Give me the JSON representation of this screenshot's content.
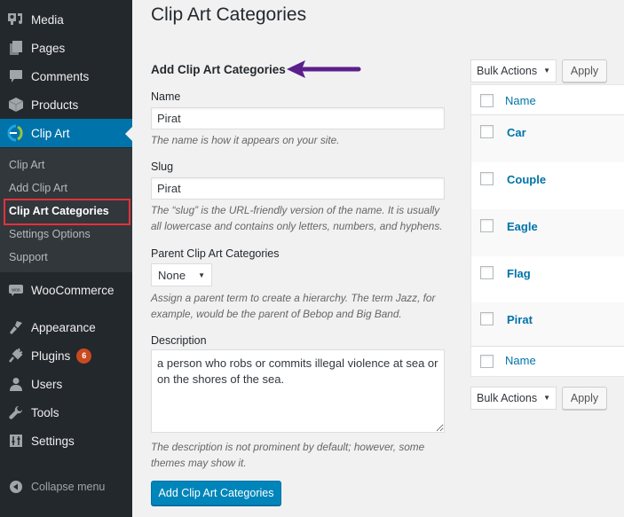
{
  "sidebar": {
    "items": [
      {
        "label": "Media",
        "icon": "media-icon"
      },
      {
        "label": "Pages",
        "icon": "pages-icon"
      },
      {
        "label": "Comments",
        "icon": "comments-icon"
      },
      {
        "label": "Products",
        "icon": "products-icon"
      },
      {
        "label": "Clip Art",
        "icon": "clip-art-icon",
        "active": true
      },
      {
        "label": "WooCommerce",
        "icon": "woocommerce-icon"
      },
      {
        "label": "Appearance",
        "icon": "appearance-icon"
      },
      {
        "label": "Plugins",
        "icon": "plugins-icon",
        "badge": "6"
      },
      {
        "label": "Users",
        "icon": "users-icon"
      },
      {
        "label": "Tools",
        "icon": "tools-icon"
      },
      {
        "label": "Settings",
        "icon": "settings-icon"
      }
    ],
    "submenu": [
      {
        "label": "Clip Art"
      },
      {
        "label": "Add Clip Art"
      },
      {
        "label": "Clip Art Categories",
        "current": true
      },
      {
        "label": "Settings Options"
      },
      {
        "label": "Support"
      }
    ],
    "collapse_label": "Collapse menu",
    "colors": {
      "background": "#23282d",
      "active": "#0073aa",
      "highlight_box": "#e2333b",
      "badge": "#ca4a1f"
    }
  },
  "main": {
    "page_title": "Clip Art Categories",
    "form": {
      "title": "Add Clip Art Categories",
      "annotation_arrow_color": "#5b1f8c",
      "name": {
        "label": "Name",
        "value": "Pirat",
        "help": "The name is how it appears on your site."
      },
      "slug": {
        "label": "Slug",
        "value": "Pirat",
        "help": "The “slug” is the URL-friendly version of the name. It is usually all lowercase and contains only letters, numbers, and hyphens."
      },
      "parent": {
        "label": "Parent Clip Art Categories",
        "value": "None",
        "help": "Assign a parent term to create a hierarchy. The term Jazz, for example, would be the parent of Bebop and Big Band."
      },
      "description": {
        "label": "Description",
        "value": "a person who robs or commits illegal violence at sea or on the shores of the sea.",
        "help": "The description is not prominent by default; however, some themes may show it."
      },
      "submit_label": "Add Clip Art Categories"
    },
    "table": {
      "bulk_actions_label": "Bulk Actions",
      "apply_label": "Apply",
      "column_name": "Name",
      "rows": [
        {
          "name": "Car"
        },
        {
          "name": "Couple"
        },
        {
          "name": "Eagle"
        },
        {
          "name": "Flag"
        },
        {
          "name": "Pirat"
        }
      ]
    }
  }
}
